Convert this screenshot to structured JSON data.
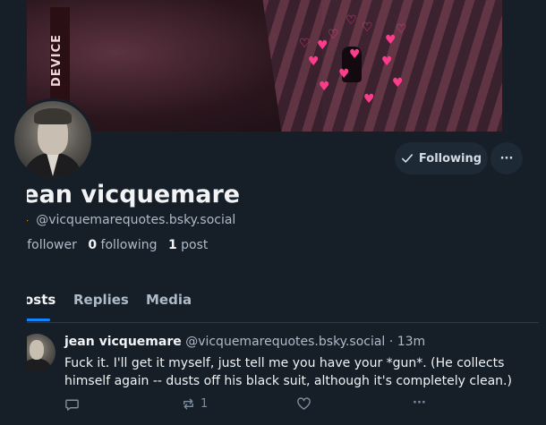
{
  "banner": {
    "side_text": "DEVICE"
  },
  "profile": {
    "display_name": "jean vicquemare",
    "emoji": "☀️",
    "handle": "@vicquemarequotes.bsky.social",
    "followers_count": "1",
    "followers_label": "follower",
    "following_count": "0",
    "following_label": "following",
    "posts_count": "1",
    "posts_label": "post"
  },
  "buttons": {
    "following_label": "Following",
    "more_label": "···"
  },
  "tabs": [
    {
      "label": "Posts",
      "active": true
    },
    {
      "label": "Replies",
      "active": false
    },
    {
      "label": "Media",
      "active": false
    }
  ],
  "post": {
    "author": "jean vicquemare",
    "handle": "@vicquemarequotes.bsky.social",
    "separator": "·",
    "time": "13m",
    "text": "Fuck it. I'll get it myself, just tell me you have your *gun*. (He collects himself again -- dusts off his black suit, although it's completely clean.)",
    "reply_count": "",
    "repost_count": "1",
    "like_count": "",
    "more_label": "···"
  },
  "colors": {
    "background": "#161e27",
    "accent": "#1185fe",
    "button_bg": "#1e2936",
    "muted_text": "#aebbc9",
    "heart_pink": "#ff3c8c"
  },
  "icons": [
    "check-icon",
    "more-icon",
    "reply-icon",
    "repost-icon",
    "like-icon"
  ]
}
